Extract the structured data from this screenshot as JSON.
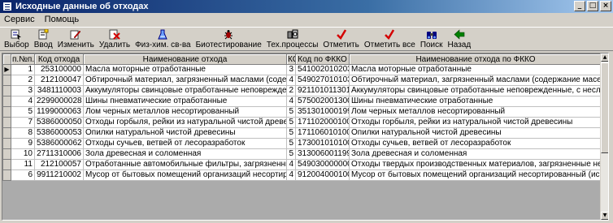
{
  "window": {
    "title": "Исходные данные об отходах",
    "buttons": [
      "_",
      "□",
      "×"
    ]
  },
  "menu": [
    {
      "id": "service",
      "label": "Сервис"
    },
    {
      "id": "help",
      "label": "Помощь"
    }
  ],
  "toolbar": [
    {
      "id": "select",
      "label": "Выбор",
      "icon": "select-icon"
    },
    {
      "id": "input",
      "label": "Ввод",
      "icon": "input-icon"
    },
    {
      "id": "edit",
      "label": "Изменить",
      "icon": "edit-icon"
    },
    {
      "id": "delete",
      "label": "Удалить",
      "icon": "delete-icon"
    },
    {
      "id": "phys-chem",
      "label": "Физ-хим. св-ва",
      "icon": "flask-icon"
    },
    {
      "id": "biotest",
      "label": "Биотестирование",
      "icon": "bug-icon"
    },
    {
      "id": "tech",
      "label": "Тех.процессы",
      "icon": "tech-icon"
    },
    {
      "id": "mark",
      "label": "Отметить",
      "icon": "check-icon"
    },
    {
      "id": "mark-all",
      "label": "Отметить все",
      "icon": "check-all-icon"
    },
    {
      "id": "search",
      "label": "Поиск",
      "icon": "binoculars-icon"
    },
    {
      "id": "back",
      "label": "Назад",
      "icon": "back-arrow-icon"
    }
  ],
  "table": {
    "columns": [
      "п.№п.",
      "Код отхода",
      "Наименование отхода",
      "КО",
      "Код по ФККО",
      "Наименование отхода по ФККО"
    ],
    "rows": [
      [
        "1",
        "253100000",
        "Масла моторные отработанные",
        "3",
        "5410020102033",
        "Масла моторные отработанные"
      ],
      [
        "2",
        "212100047",
        "Обтирочный материал, загрязненный маслами (содержание масел 15% и",
        "4",
        "5490270101033",
        "Обтирочный материал, загрязненный маслами (содержание масел 15 %"
      ],
      [
        "3",
        "3481110003",
        "Аккумуляторы свинцовые отработанные неповрежденные, с неслитым э",
        "2",
        "9211010113012",
        "Аккумуляторы свинцовые отработанные неповрежденные, с неслитым э"
      ],
      [
        "4",
        "2299000028",
        "Шины пневматические отработанные",
        "4",
        "5750020013004",
        "Шины пневматические отработанные"
      ],
      [
        "5",
        "1199000063",
        "Лом черных металлов несортированный",
        "5",
        "3513010001995",
        "Лом черных металлов несортированный"
      ],
      [
        "7",
        "5386000050",
        "Отходы горбыля, рейки из натуральной чистой древесины",
        "5",
        "1711020001005",
        "Отходы горбыля, рейки из натуральной чистой древесины"
      ],
      [
        "8",
        "5386000053",
        "Опилки натуральной чистой древесины",
        "5",
        "1711060101005",
        "Опилки натуральной чистой древесины"
      ],
      [
        "9",
        "5386000062",
        "Отходы сучьев, ветвей от лесоразработок",
        "5",
        "1730010101005",
        "Отходы сучьев, ветвей от лесоразработок"
      ],
      [
        "10",
        "2711310006",
        "Зола древесная и соломенная",
        "5",
        "3130060011995",
        "Зола древесная и соломенная"
      ],
      [
        "11",
        "212100057",
        "Отработанные автомобильные фильтры, загрязненные нефтепродуктам",
        "4",
        "5490300000000",
        "Отходы твердых производственных материалов, загрязненные нефтяны"
      ],
      [
        "6",
        "9911210002",
        "Мусор от бытовых помещений организаций несортированный (исключая",
        "4",
        "9120040001004",
        "Мусор от бытовых помещений организаций несортированный (исключая"
      ]
    ]
  },
  "colors": {
    "title_start": "#0a246a",
    "title_end": "#a6caf0",
    "check_red": "#d40000",
    "face": "#d4d0c8"
  }
}
